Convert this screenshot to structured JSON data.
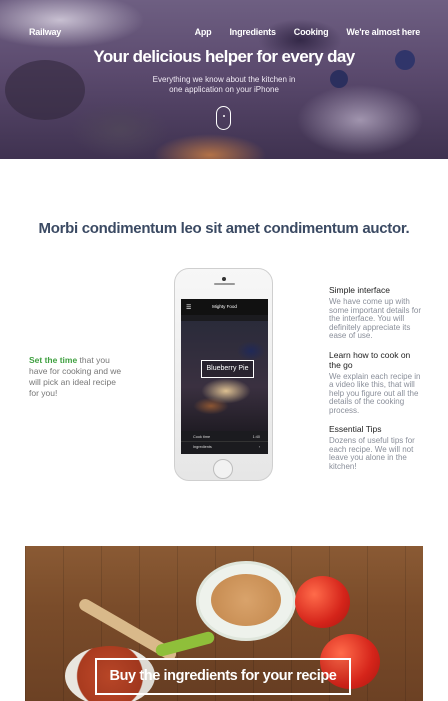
{
  "nav": {
    "brand": "Railway",
    "links": [
      "App",
      "Ingredients",
      "Cooking",
      "We're almost here"
    ]
  },
  "hero": {
    "title": "Your delicious helper for every day",
    "subtitle_line1": "Everything we know about the kitchen in",
    "subtitle_line2": "one application on your iPhone"
  },
  "section": {
    "headline": "Morbi condimentum leo sit amet condimentum auctor.",
    "left_highlight": "Set the time",
    "left_text": " that you have for cooking and we will pick an ideal recipe for you!"
  },
  "phone": {
    "app_title": "Mighty Food",
    "menu_icon": "☰",
    "recipe_label": "Blueberry Pie",
    "row1_left": "Cook time",
    "row1_right": "1:40",
    "row2_left": "Ingredients",
    "row2_right": "›"
  },
  "features": [
    {
      "title": "Simple interface",
      "text": "We have come up with some important details for the interface. You will definitely appreciate its ease of use."
    },
    {
      "title": "Learn how to cook on the go",
      "text": "We explain each recipe in a video like this, that will help you figure out all the details of the cooking process."
    },
    {
      "title": "Essential Tips",
      "text": "Dozens of useful tips for each recipe. We will not leave you alone in the kitchen!"
    }
  ],
  "cta": {
    "label": "Buy the ingredients for your recipe"
  }
}
